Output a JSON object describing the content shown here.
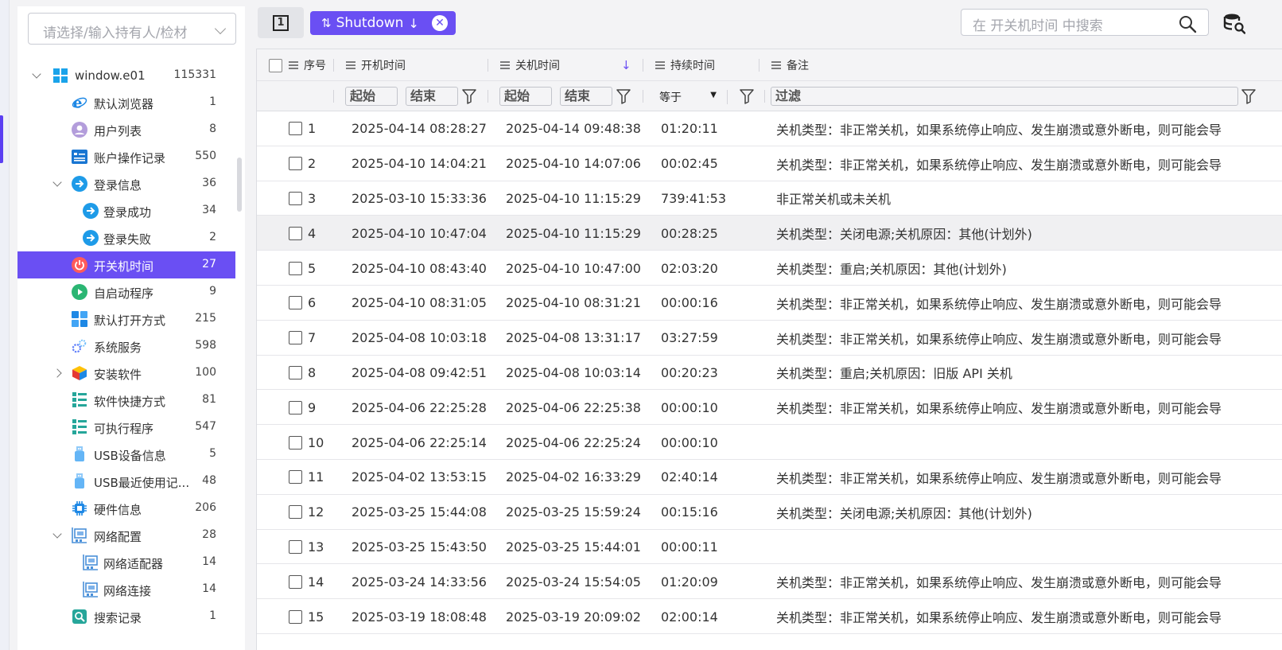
{
  "sidebar": {
    "holder_placeholder": "请选择/输入持有人/检材",
    "items": [
      {
        "label": "window.e01",
        "count": "115331",
        "icon": "windows-icon",
        "level": 0,
        "arrow": "down"
      },
      {
        "label": "默认浏览器",
        "count": "1",
        "icon": "ie-browser-icon",
        "level": 1
      },
      {
        "label": "用户列表",
        "count": "8",
        "icon": "user-icon",
        "level": 1
      },
      {
        "label": "账户操作记录",
        "count": "550",
        "icon": "account-log-icon",
        "level": 1
      },
      {
        "label": "登录信息",
        "count": "36",
        "icon": "login-icon",
        "level": 1,
        "arrow": "down"
      },
      {
        "label": "登录成功",
        "count": "34",
        "icon": "login-success-icon",
        "level": 2
      },
      {
        "label": "登录失败",
        "count": "2",
        "icon": "login-fail-icon",
        "level": 2
      },
      {
        "label": "开关机时间",
        "count": "27",
        "icon": "power-icon",
        "level": 1,
        "active": true
      },
      {
        "label": "自启动程序",
        "count": "9",
        "icon": "autostart-icon",
        "level": 1
      },
      {
        "label": "默认打开方式",
        "count": "215",
        "icon": "open-with-icon",
        "level": 1
      },
      {
        "label": "系统服务",
        "count": "598",
        "icon": "service-icon",
        "level": 1
      },
      {
        "label": "安装软件",
        "count": "100",
        "icon": "package-icon",
        "level": 1,
        "arrow": "right"
      },
      {
        "label": "软件快捷方式",
        "count": "81",
        "icon": "shortcut-icon",
        "level": 1
      },
      {
        "label": "可执行程序",
        "count": "547",
        "icon": "executable-icon",
        "level": 1
      },
      {
        "label": "USB设备信息",
        "count": "5",
        "icon": "usb-icon",
        "level": 1
      },
      {
        "label": "USB最近使用记...",
        "count": "48",
        "icon": "usb-recent-icon",
        "level": 1
      },
      {
        "label": "硬件信息",
        "count": "206",
        "icon": "hardware-chip-icon",
        "level": 1
      },
      {
        "label": "网络配置",
        "count": "28",
        "icon": "network-icon",
        "level": 1,
        "arrow": "down"
      },
      {
        "label": "网络适配器",
        "count": "14",
        "icon": "network-adapter-icon",
        "level": 2
      },
      {
        "label": "网络连接",
        "count": "14",
        "icon": "network-connection-icon",
        "level": 2
      },
      {
        "label": "搜索记录",
        "count": "1",
        "icon": "search-record-icon",
        "level": 1
      }
    ]
  },
  "toolbar": {
    "panel_toggle_label": "1",
    "sort_chip": {
      "field": "Shutdown",
      "direction": "↓"
    },
    "search_placeholder": "在 开关机时间 中搜索"
  },
  "table": {
    "headers": {
      "no": "序号",
      "start": "开机时间",
      "end": "关机时间",
      "duration": "持续时间",
      "note": "备注"
    },
    "filters": {
      "start_from": "起始",
      "start_to": "结束",
      "end_from": "起始",
      "end_to": "结束",
      "duration_op": "等于",
      "note_filter": "过滤"
    },
    "rows": [
      {
        "no": "1",
        "start": "2025-04-14 08:28:27",
        "end": "2025-04-14 09:48:38",
        "duration": "01:20:11",
        "note": "关机类型：非正常关机，如果系统停止响应、发生崩溃或意外断电，则可能会导"
      },
      {
        "no": "2",
        "start": "2025-04-10 14:04:21",
        "end": "2025-04-10 14:07:06",
        "duration": "00:02:45",
        "note": "关机类型：非正常关机，如果系统停止响应、发生崩溃或意外断电，则可能会导"
      },
      {
        "no": "3",
        "start": "2025-03-10 15:33:36",
        "end": "2025-04-10 11:15:29",
        "duration": "739:41:53",
        "note": "非正常关机或未关机"
      },
      {
        "no": "4",
        "start": "2025-04-10 10:47:04",
        "end": "2025-04-10 11:15:29",
        "duration": "00:28:25",
        "note": "关机类型：关闭电源;关机原因：其他(计划外)",
        "highlight": true
      },
      {
        "no": "5",
        "start": "2025-04-10 08:43:40",
        "end": "2025-04-10 10:47:00",
        "duration": "02:03:20",
        "note": "关机类型：重启;关机原因：其他(计划外)"
      },
      {
        "no": "6",
        "start": "2025-04-10 08:31:05",
        "end": "2025-04-10 08:31:21",
        "duration": "00:00:16",
        "note": "关机类型：非正常关机，如果系统停止响应、发生崩溃或意外断电，则可能会导"
      },
      {
        "no": "7",
        "start": "2025-04-08 10:03:18",
        "end": "2025-04-08 13:31:17",
        "duration": "03:27:59",
        "note": "关机类型：非正常关机，如果系统停止响应、发生崩溃或意外断电，则可能会导"
      },
      {
        "no": "8",
        "start": "2025-04-08 09:42:51",
        "end": "2025-04-08 10:03:14",
        "duration": "00:20:23",
        "note": "关机类型：重启;关机原因：旧版 API 关机"
      },
      {
        "no": "9",
        "start": "2025-04-06 22:25:28",
        "end": "2025-04-06 22:25:38",
        "duration": "00:00:10",
        "note": "关机类型：非正常关机，如果系统停止响应、发生崩溃或意外断电，则可能会导"
      },
      {
        "no": "10",
        "start": "2025-04-06 22:25:14",
        "end": "2025-04-06 22:25:24",
        "duration": "00:00:10",
        "note": ""
      },
      {
        "no": "11",
        "start": "2025-04-02 13:53:15",
        "end": "2025-04-02 16:33:29",
        "duration": "02:40:14",
        "note": "关机类型：非正常关机，如果系统停止响应、发生崩溃或意外断电，则可能会导"
      },
      {
        "no": "12",
        "start": "2025-03-25 15:44:08",
        "end": "2025-03-25 15:59:24",
        "duration": "00:15:16",
        "note": "关机类型：关闭电源;关机原因：其他(计划外)"
      },
      {
        "no": "13",
        "start": "2025-03-25 15:43:50",
        "end": "2025-03-25 15:44:01",
        "duration": "00:00:11",
        "note": ""
      },
      {
        "no": "14",
        "start": "2025-03-24 14:33:56",
        "end": "2025-03-24 15:54:05",
        "duration": "01:20:09",
        "note": "关机类型：非正常关机，如果系统停止响应、发生崩溃或意外断电，则可能会导"
      },
      {
        "no": "15",
        "start": "2025-03-19 18:08:48",
        "end": "2025-03-19 20:09:02",
        "duration": "02:00:14",
        "note": "关机类型：非正常关机，如果系统停止响应、发生崩溃或意外断电，则可能会导"
      }
    ]
  },
  "colors": {
    "accent": "#6a4ff3",
    "header_bg": "#f4f4f6",
    "row_highlight": "#f0f0f2"
  }
}
